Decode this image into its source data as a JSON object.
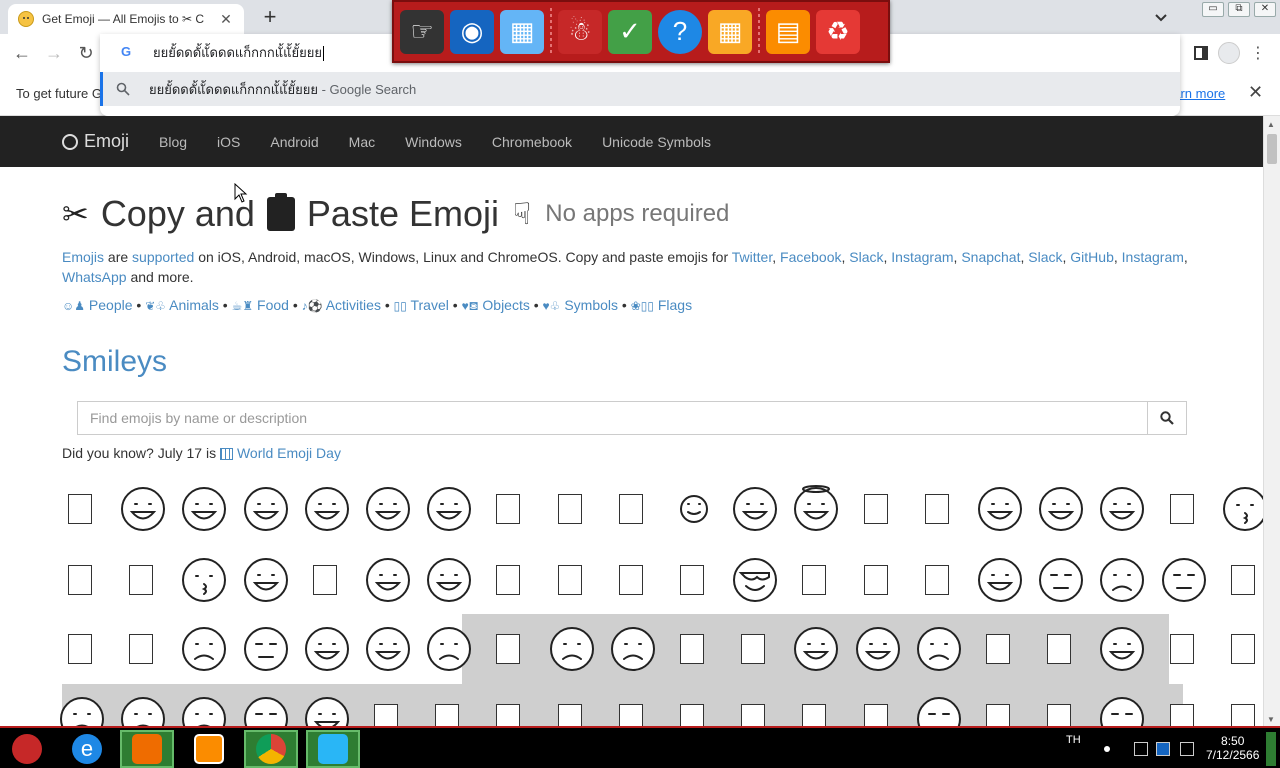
{
  "browser": {
    "tab_title": "Get Emoji — All Emojis to ✂ C",
    "tab_close": "✕",
    "new_tab": "+",
    "omnibox_text": "ยยยั้ดดดั้แั้ดดดแก็กกกแั้แั้ยั้ยยย",
    "suggestion_text": "ยยยั้ดดดั้แั้ดดดแก็กกกแั้แั้ยั้ยยย",
    "suggestion_suffix": " - Google Search",
    "win_min": "▭",
    "win_restore": "⧉",
    "win_close": "✕",
    "infobar_text": "To get future G",
    "infobar_link": "earn more",
    "infobar_close": "✕"
  },
  "site_nav": {
    "brand": "Emoji",
    "links": [
      "Blog",
      "iOS",
      "Android",
      "Mac",
      "Windows",
      "Chromebook",
      "Unicode Symbols"
    ]
  },
  "hero": {
    "part1": "Copy and",
    "part2": "Paste Emoji",
    "subtitle": "No apps required"
  },
  "desc": {
    "link1": "Emojis",
    "t1": " are ",
    "link2": "supported",
    "t2": " on iOS, Android, macOS, Windows, Linux and ChromeOS. Copy and paste emojis for ",
    "platforms": [
      "Twitter",
      "Facebook",
      "Slack",
      "Instagram",
      "Snapchat",
      "Slack",
      "GitHub",
      "Instagram",
      "WhatsApp"
    ],
    "t3": " and more."
  },
  "categories": [
    {
      "icon": "☺♟",
      "label": "People"
    },
    {
      "icon": "❦♧",
      "label": "Animals"
    },
    {
      "icon": "☕♜",
      "label": "Food"
    },
    {
      "icon": "♪⚽",
      "label": "Activities"
    },
    {
      "icon": "▯▯",
      "label": "Travel"
    },
    {
      "icon": "♥⛾",
      "label": "Objects"
    },
    {
      "icon": "♥♧",
      "label": "Symbols"
    },
    {
      "icon": "❀▯▯",
      "label": "Flags"
    }
  ],
  "smileys_heading": "Smileys",
  "search": {
    "placeholder": "Find emojis by name or description"
  },
  "did_you_know": {
    "text": "Did you know? July 17 is ",
    "link": "World Emoji Day"
  },
  "emoji_rows": [
    [
      "tofu",
      "grin",
      "grin-big",
      "grin-teeth",
      "laugh",
      "sweat-grin",
      "sweat-grin",
      "tofu",
      "tofu",
      "tofu",
      "small-smile",
      "smile",
      "halo",
      "tofu",
      "tofu",
      "wink",
      "sweat",
      "heart-eyes",
      "tofu",
      "kiss"
    ],
    [
      "tofu",
      "tofu",
      "kiss",
      "tongue",
      "tofu",
      "squint-tongue",
      "tongue-out",
      "tofu",
      "tofu",
      "tofu",
      "tofu",
      "cool",
      "tofu",
      "tofu",
      "tofu",
      "smirk",
      "unamused",
      "worried",
      "expressionless",
      "tofu"
    ],
    [
      "tofu",
      "tofu",
      "frown",
      "confounded",
      "surprised",
      "relieved",
      "worried-brow",
      "tofu",
      "sad-tear",
      "crying",
      "tofu",
      "tofu",
      "grin",
      "grimace",
      "worried",
      "tofu",
      "tofu",
      "laugh-tongue",
      "tofu",
      "tofu"
    ],
    [
      "gasp",
      "confused",
      "cold-sweat",
      "hushed",
      "sweat",
      "tofu",
      "tofu",
      "tofu",
      "tofu",
      "tofu",
      "tofu",
      "tofu",
      "tofu",
      "tofu",
      "neutral",
      "tofu",
      "tofu",
      "mouth",
      "tofu",
      "tofu",
      "tofu",
      "tofu"
    ]
  ],
  "taskbar": {
    "lang": "TH",
    "time": "8:50",
    "date": "7/12/2566"
  }
}
